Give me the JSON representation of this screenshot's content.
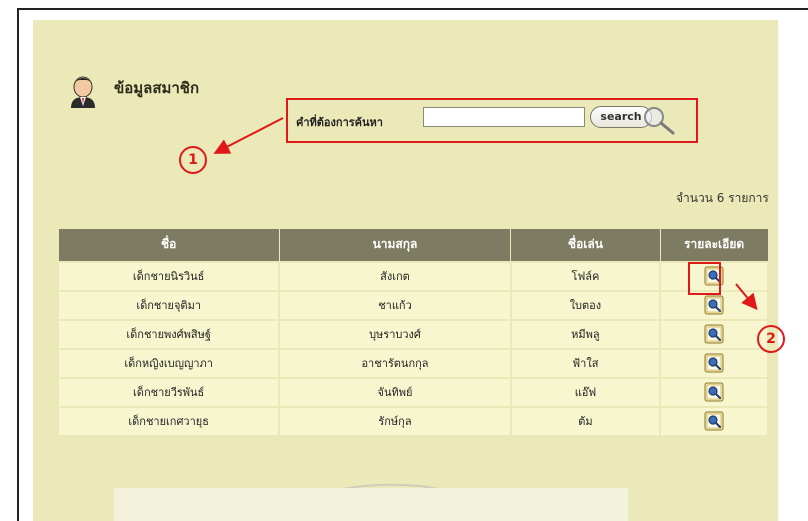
{
  "header": {
    "title": "ข้อมูลสมาชิก",
    "icon": "user-avatar-icon"
  },
  "search": {
    "label": "คำที่ต้องการค้นหา",
    "input_value": "",
    "button_label": "search",
    "icon": "magnifier-icon"
  },
  "summary": {
    "count_text": "จำนวน 6 รายการ"
  },
  "table": {
    "headers": [
      "ชื่อ",
      "นามสกุล",
      "ชื่อเล่น",
      "รายละเอียด"
    ],
    "rows": [
      {
        "first": "เด็กชายนิรวินธ์",
        "last": "สังเกต",
        "nick": "โฟล์ค"
      },
      {
        "first": "เด็กชายจุติมา",
        "last": "ชาแก้ว",
        "nick": "ใบตอง"
      },
      {
        "first": "เด็กชายพงศ์พสิษฐ์",
        "last": "บุษราบวงศ์",
        "nick": "หมีพลู"
      },
      {
        "first": "เด็กหญิงเบญญาภา",
        "last": "อาชารัตนกกุล",
        "nick": "ฟ้าใส"
      },
      {
        "first": "เด็กชายวีรพันธ์",
        "last": "จันทิพย์",
        "nick": "แอ๊ฟ"
      },
      {
        "first": "เด็กชายเกศวายุธ",
        "last": "รักษ์กุล",
        "nick": "ต้ม"
      }
    ],
    "detail_icon": "detail-view-icon"
  },
  "annotations": {
    "step1": "1",
    "step2": "2"
  },
  "colors": {
    "panel": "#ebe9b8",
    "header_row": "#7d7c63",
    "row": "#f7f6cf",
    "highlight": "#e01818"
  }
}
